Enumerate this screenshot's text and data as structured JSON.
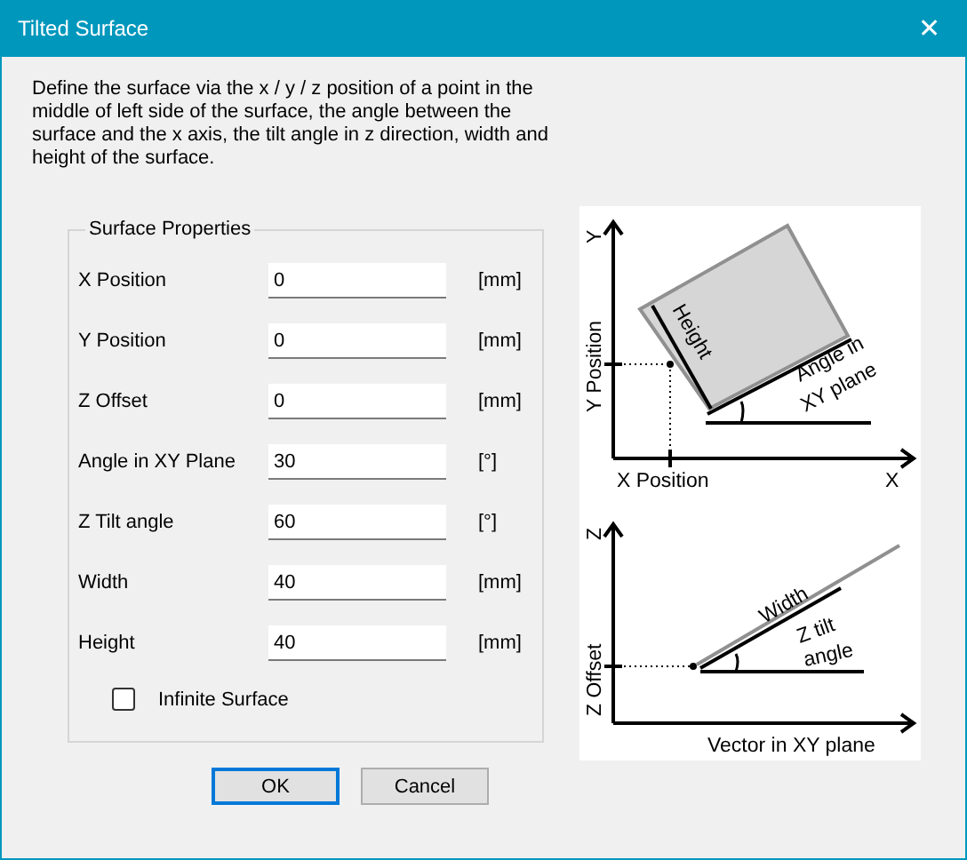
{
  "window": {
    "title": "Tilted Surface",
    "close": "✕"
  },
  "description": "Define the surface via the x / y / z position of a point in the middle of left side of the surface, the angle between the surface  and the x axis, the tilt angle in z direction, width and height of the surface.",
  "group": {
    "title": "Surface Properties",
    "fields": [
      {
        "label": "X Position",
        "value": "0",
        "unit": "[mm]"
      },
      {
        "label": "Y Position",
        "value": "0",
        "unit": "[mm]"
      },
      {
        "label": "Z Offset",
        "value": "0",
        "unit": "[mm]"
      },
      {
        "label": "Angle in XY Plane",
        "value": "30",
        "unit": "[°]"
      },
      {
        "label": "Z Tilt angle",
        "value": "60",
        "unit": "[°]"
      },
      {
        "label": "Width",
        "value": "40",
        "unit": "[mm]"
      },
      {
        "label": "Height",
        "value": "40",
        "unit": "[mm]"
      }
    ],
    "checkbox": {
      "label": "Infinite Surface",
      "checked": false
    }
  },
  "xy_diagram": {
    "y_axis": "Y",
    "y_position": "Y Position",
    "height": "Height",
    "angle_1": "Angle in",
    "angle_2": "XY  plane",
    "x_position": "X Position",
    "x_axis": "X"
  },
  "z_diagram": {
    "z_axis": "Z",
    "z_offset": "Z Offset",
    "width": "Width",
    "tilt_1": "Z tilt",
    "tilt_2": "angle",
    "vector": "Vector in XY  plane"
  },
  "buttons": [
    {
      "label": "OK",
      "default": true
    },
    {
      "label": "Cancel",
      "default": false
    }
  ]
}
